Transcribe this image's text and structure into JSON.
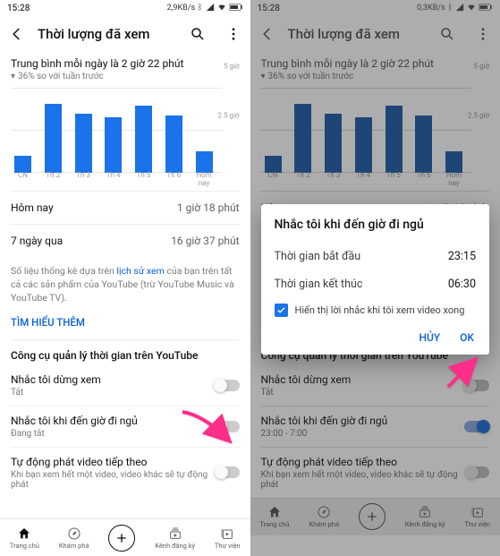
{
  "status": {
    "time": "15:28",
    "speed_left": "2,9KB/s",
    "speed_right": "0,3KB/s"
  },
  "appbar": {
    "title": "Thời lượng đã xem"
  },
  "summary": {
    "avg": "Trung bình mỗi ngày là 2 giờ 22 phút",
    "delta": "36% so với tuần trước"
  },
  "rows": {
    "today_label": "Hôm nay",
    "today_val": "1 giờ 18 phút",
    "week_label": "7 ngày qua",
    "week_val": "16 giờ 37 phút"
  },
  "note": {
    "prefix": "Số liệu thống kê dựa trên ",
    "link": "lịch sử xem",
    "suffix": " của bạn trên tất cả các sản phẩm của YouTube (trừ YouTube Music và YouTube TV).",
    "learn": "TÌM HIỂU THÊM"
  },
  "section": "Công cụ quản lý thời gian trên YouTube",
  "settings": [
    {
      "t": "Nhắc tôi dừng xem",
      "s": "Tắt"
    },
    {
      "t": "Nhắc tôi khi đến giờ đi ngủ",
      "s": "Đang tắt"
    },
    {
      "t": "Tự động phát video tiếp theo",
      "s": "Khi bạn xem hết một video, video khác sẽ tự động phát"
    }
  ],
  "settings_r": [
    {
      "t": "Nhắc tôi dừng xem",
      "s": "Tắt"
    },
    {
      "t": "Nhắc tôi khi đến giờ đi ngủ",
      "s": "23:00 - 7:00"
    },
    {
      "t": "Tự động phát video tiếp theo",
      "s": "Khi bạn xem hết một video, video khác sẽ tự động phát"
    }
  ],
  "nav": [
    "Trang chủ",
    "Khám phá",
    "Kênh đăng ký",
    "Thư viện"
  ],
  "dialog": {
    "title": "Nhắc tôi khi đến giờ đi ngủ",
    "start_label": "Thời gian bắt đầu",
    "start_val": "23:15",
    "end_label": "Thời gian kết thúc",
    "end_val": "06:30",
    "chk": "Hiển thị lời nhắc khi tôi xem video xong",
    "cancel": "HỦY",
    "ok": "OK"
  },
  "chart_data": {
    "type": "bar",
    "categories": [
      "CN",
      "Th 2",
      "Th 3",
      "Th 4",
      "Th 5",
      "Th 6",
      "Hôm nay"
    ],
    "values": [
      1.0,
      4.1,
      3.5,
      3.3,
      4.0,
      3.4,
      1.3
    ],
    "ylabel": "giờ",
    "ylim": [
      0,
      5
    ],
    "gridlines": [
      2.5,
      5
    ],
    "grid_labels": [
      "2.5 giờ",
      "5 giờ"
    ]
  }
}
